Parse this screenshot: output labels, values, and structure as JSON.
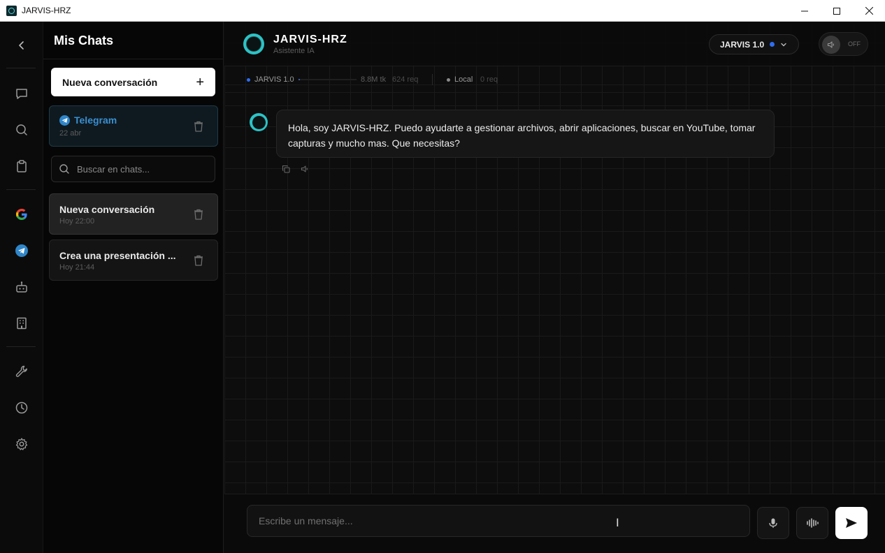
{
  "window": {
    "title": "JARVIS-HRZ"
  },
  "sidebar": {
    "title": "Mis Chats",
    "new_chat_label": "Nueva conversación",
    "search_placeholder": "Buscar en chats...",
    "telegram": {
      "title": "Telegram",
      "date": "22 abr"
    },
    "conversations": [
      {
        "title": "Nueva conversación",
        "date": "Hoy 22:00",
        "active": true
      },
      {
        "title": "Crea una presentación ...",
        "date": "Hoy 21:44",
        "active": false
      }
    ]
  },
  "rail": {
    "icons": [
      "back-icon",
      "chat-icon",
      "search-icon",
      "clipboard-icon",
      "google-icon",
      "telegram-icon",
      "robot-icon",
      "building-icon",
      "wrench-icon",
      "history-icon",
      "settings-icon"
    ]
  },
  "header": {
    "brand": "JARVIS-HRZ",
    "subtitle": "Asistente IA",
    "model": "JARVIS 1.0",
    "voice_toggle": "OFF"
  },
  "stats": {
    "primary_model": "JARVIS 1.0",
    "tokens": "8.8M tk",
    "requests": "624 req",
    "local_label": "Local",
    "local_requests": "0 req"
  },
  "messages": [
    {
      "role": "assistant",
      "text": "Hola, soy JARVIS-HRZ. Puedo ayudarte a gestionar archivos, abrir aplicaciones, buscar en YouTube, tomar capturas y mucho mas. Que necesitas?"
    }
  ],
  "composer": {
    "placeholder": "Escribe un mensaje..."
  },
  "colors": {
    "accent_cyan": "#2cc3c6",
    "telegram_blue": "#2f86c9",
    "model_dot": "#2f6df0",
    "background": "#0d0d0d"
  }
}
